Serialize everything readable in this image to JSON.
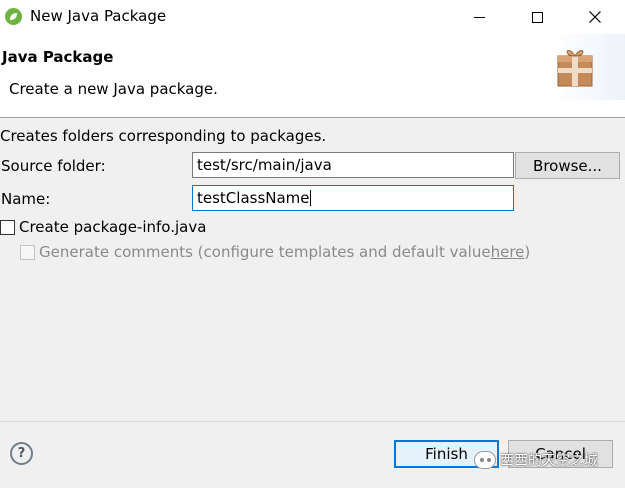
{
  "window": {
    "title": "New Java Package",
    "minimize_icon": "minimize-icon",
    "maximize_icon": "maximize-icon",
    "close_icon": "close-icon"
  },
  "banner": {
    "title": "Java Package",
    "description": "Create a new Java package.",
    "icon": "package-icon"
  },
  "form": {
    "info": "Creates folders corresponding to packages.",
    "source_folder_label": "Source folder:",
    "source_folder_value": "test/src/main/java",
    "browse_label": "Browse...",
    "name_label": "Name:",
    "name_value": "testClassName",
    "create_package_info_label": "Create package-info.java",
    "create_package_info_checked": false,
    "generate_comments_label": "Generate comments (configure templates and default value ",
    "generate_comments_link": "here",
    "generate_comments_suffix": ")",
    "generate_comments_checked": false,
    "generate_comments_enabled": false
  },
  "footer": {
    "help_icon": "help-icon",
    "finish_label": "Finish",
    "cancel_label": "Cancel",
    "watermark_text": "西西的天空之城"
  }
}
